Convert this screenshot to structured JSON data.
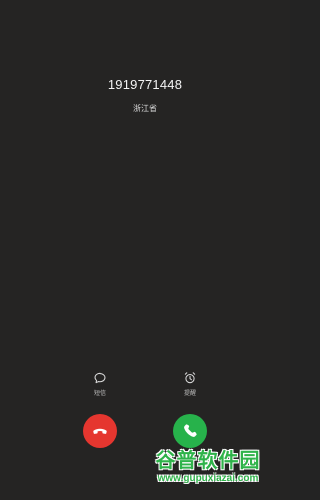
{
  "caller": {
    "number": "1919771448",
    "location": "浙江省"
  },
  "quick_actions": {
    "message": {
      "label": "短信",
      "icon": "message-bubble-icon"
    },
    "reminder": {
      "label": "提醒",
      "icon": "alarm-clock-icon"
    }
  },
  "call_controls": {
    "decline": {
      "icon": "phone-hangup-icon",
      "color": "#e5362f"
    },
    "answer": {
      "icon": "phone-answer-icon",
      "color": "#27b24b"
    }
  },
  "watermark": {
    "title": "谷普软件园",
    "url": "www.gupuxiazai.com"
  }
}
